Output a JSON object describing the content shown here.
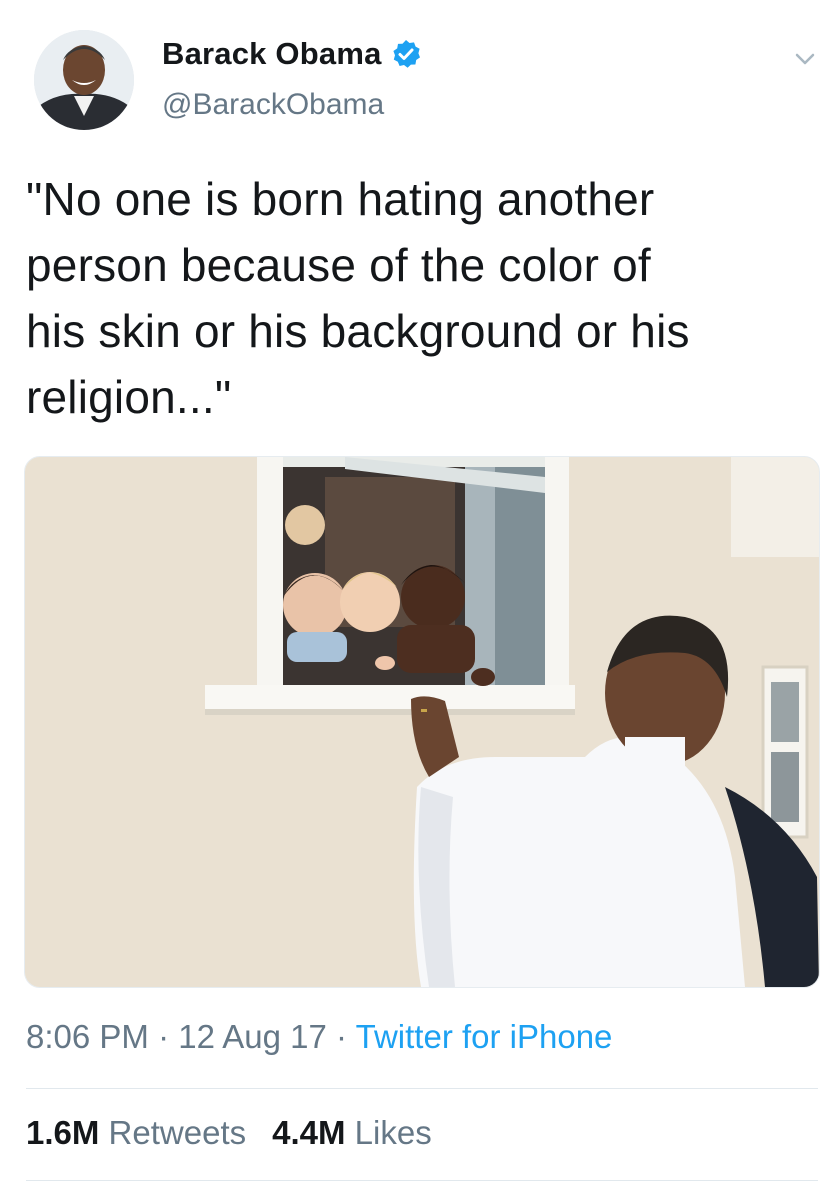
{
  "author": {
    "name": "Barack Obama",
    "handle": "@BarackObama",
    "verified_color": "#1da1f2"
  },
  "tweet": {
    "text": "\"No one is born hating another\nperson because of the color of\nhis skin or his background or his\nreligion...\""
  },
  "meta": {
    "time": "8:06 PM",
    "sep1": " · ",
    "date": "12 Aug 17",
    "sep2": " · ",
    "source": "Twitter for iPhone"
  },
  "stats": {
    "retweets_count": "1.6M",
    "retweets_label": "Retweets",
    "likes_count": "4.4M",
    "likes_label": "Likes"
  },
  "icons": {
    "verified": "verified-badge-icon",
    "more": "chevron-down-icon"
  },
  "colors": {
    "text": "#14171a",
    "secondary": "#657786",
    "link": "#1da1f2"
  }
}
